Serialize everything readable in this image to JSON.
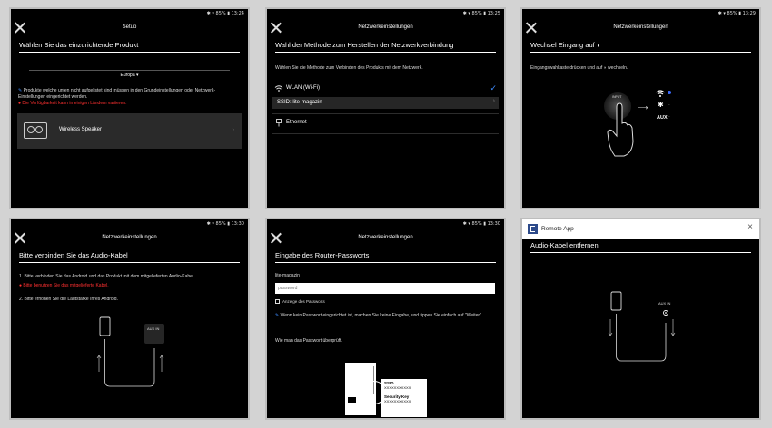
{
  "status": {
    "p1": "✱ ▾ 85% ▮ 13:24",
    "p2": "✱ ▾ 85% ▮ 13:25",
    "p3": "✱ ▾ 85% ▮ 13:29",
    "p4": "✱ ▾ 85% ▮ 13:30",
    "p5": "✱ ▾ 85% ▮ 13:30"
  },
  "p1": {
    "topbar_title": "Setup",
    "heading": "Wählen Sie das einzurichtende Produkt",
    "region": "Europa ▾",
    "info_note": "Produkte welche unten nicht aufgelistet sind müssen in den Grundeinstellungen oder Netzwerk-Einstellungen eingerichtet werden.",
    "warning_note": "Die Verfügbarkeit kann in einigen Ländern variieren.",
    "product_label": "Wireless Speaker"
  },
  "p2": {
    "topbar_title": "Netzwerkeinstellungen",
    "heading": "Wahl der Methode zum Herstellen der Netzwerkverbindung",
    "intro": "Wählen Sie die Methode zum Verbinden des Produkts mit dem Netzwerk.",
    "wifi_label": "WLAN (Wi-Fi)",
    "ssid_label": "SSID: lite-magazin",
    "ethernet_label": "Ethernet"
  },
  "p3": {
    "topbar_title": "Netzwerkeinstellungen",
    "heading": "Wechsel Eingang auf",
    "instruction": "Eingangswahltaste drücken und auf",
    "instruction_suffix": "wechseln.",
    "input_label": "INPUT",
    "aux_label": "AUX"
  },
  "p4": {
    "topbar_title": "Netzwerkeinstellungen",
    "heading": "Bitte verbinden Sie das Audio-Kabel",
    "step1": "1. Bitte verbinden Sie das Android und das Produkt mit dem mitgelieferten Audio-Kabel.",
    "warning": "Bitte benutzen Sie das mitgelieferte Kabel.",
    "step2": "2. Bitte erhöhen Sie die Lautstärke Ihres Android.",
    "aux_in_label": "AUX IN"
  },
  "p5": {
    "topbar_title": "Netzwerkeinstellungen",
    "heading": "Eingabe des Router-Passworts",
    "ssid": "lite-magazin",
    "password_placeholder": "password",
    "show_password_label": "Anzeige des Passworts",
    "info": "Wenn kein Passwort eingerichtet ist, machen Sie keine Eingabe, und tippen Sie einfach auf \"Weiter\".",
    "check_link": "Wie man das Passwort überprüft.",
    "label_ssid": "SSID",
    "label_ssid_value": "XXXXXXXXXXX",
    "label_key": "Security Key",
    "label_key_value": "XXXXXXXXXXX"
  },
  "p6": {
    "window_title": "Remote App",
    "heading": "Audio-Kabel entfernen",
    "aux_in_label": "AUX IN"
  }
}
